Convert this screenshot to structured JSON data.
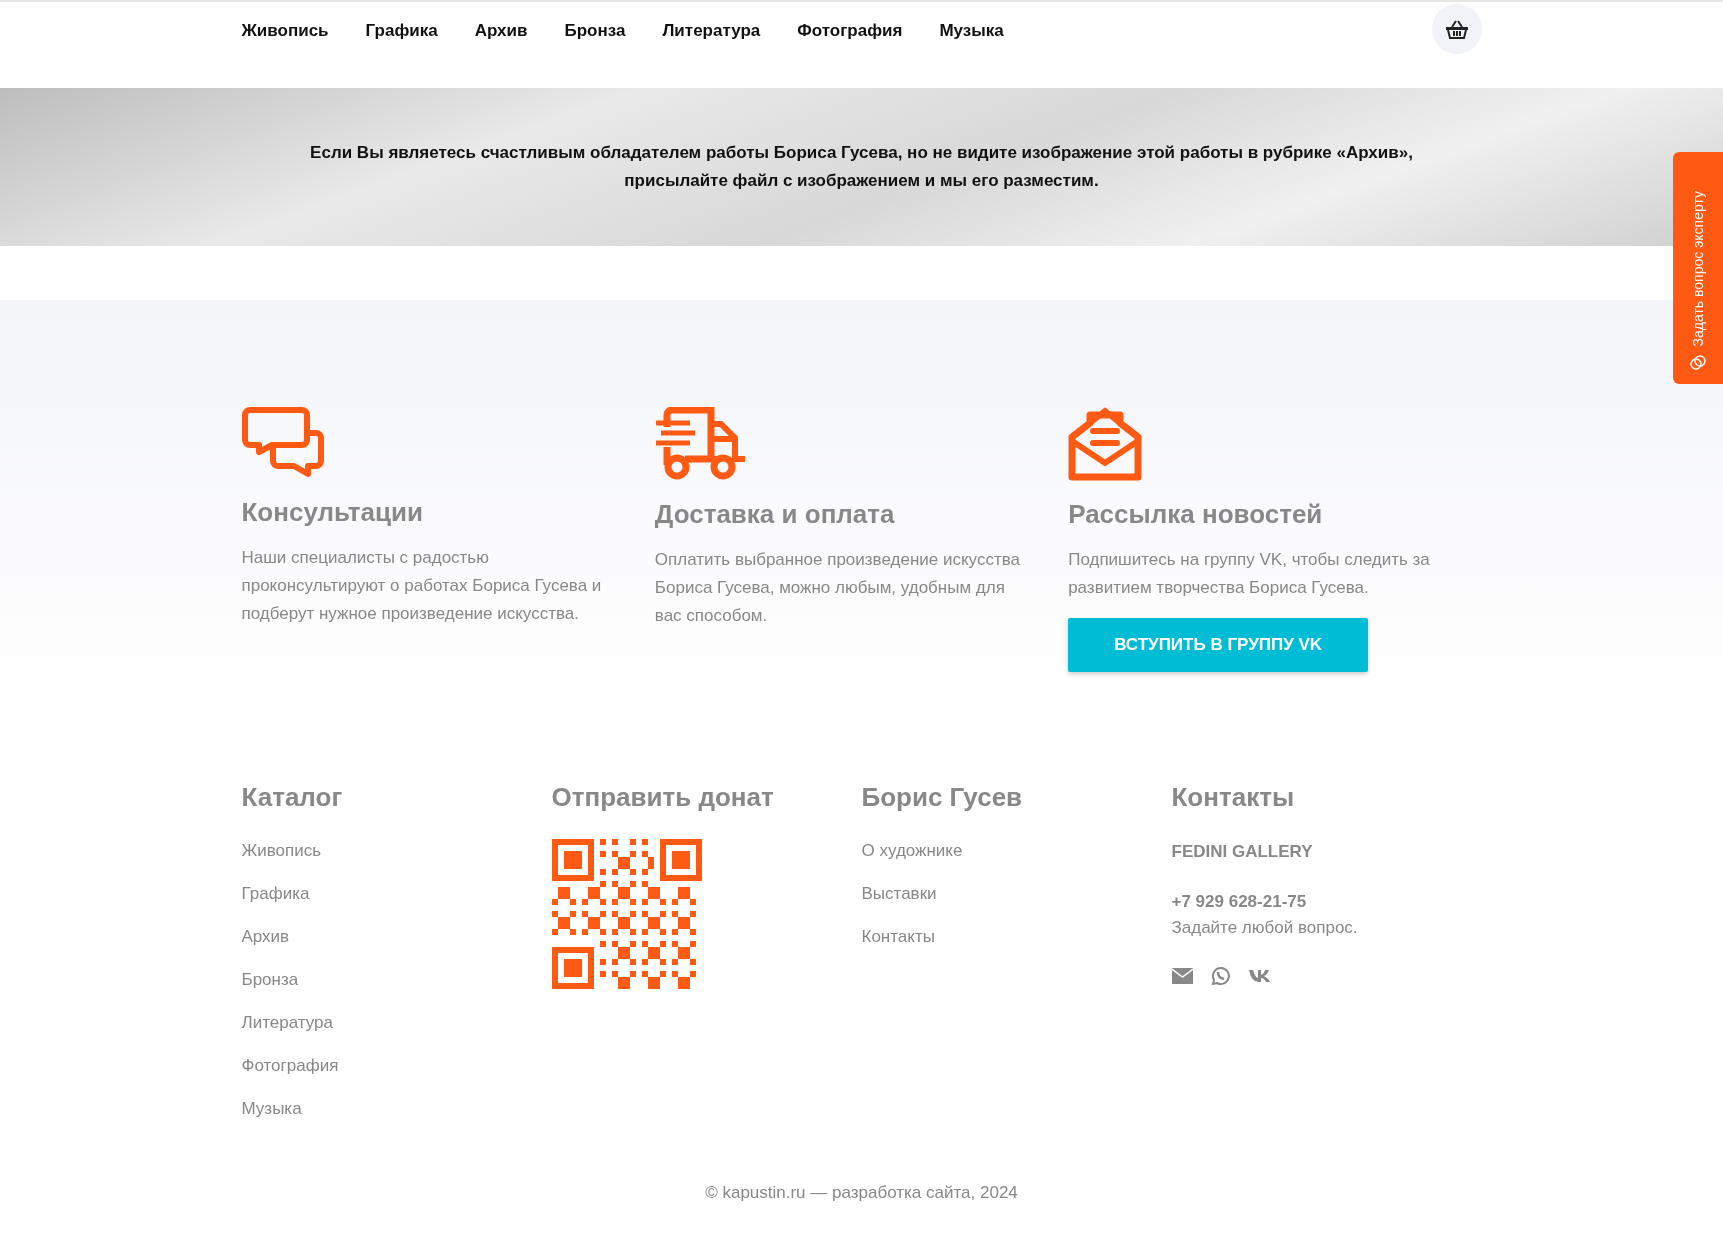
{
  "nav": {
    "items": [
      {
        "label": "Живопись"
      },
      {
        "label": "Графика"
      },
      {
        "label": "Архив"
      },
      {
        "label": "Бронза"
      },
      {
        "label": "Литература"
      },
      {
        "label": "Фотография"
      },
      {
        "label": "Музыка"
      }
    ]
  },
  "banner": {
    "text": "Если Вы являетесь счастливым обладателем работы Бориса Гусева, но не видите изображение этой работы в рубрике «Архив», присылайте файл с изображением и мы его разместим."
  },
  "side_tab": {
    "label": "Задать вопрос эксперту"
  },
  "features": [
    {
      "kind": "chat",
      "title": "Консультации",
      "text": "Наши специалисты с радостью проконсультируют о работах Бориса Гусева и подберут нужное произведение искусства."
    },
    {
      "kind": "truck",
      "title": "Доставка и оплата",
      "text": "Оплатить выбранное произведение искусства Бориса Гусева, можно любым, удобным для вас способом."
    },
    {
      "kind": "mail",
      "title": "Рассылка новостей",
      "text": "Подпишитесь на группу VK, чтобы следить за развитием творчества Бориса Гусева.",
      "button": "ВСТУПИТЬ В ГРУППУ VK"
    }
  ],
  "footer": {
    "catalog": {
      "title": "Каталог",
      "links": [
        "Живопись",
        "Графика",
        "Архив",
        "Бронза",
        "Литература",
        "Фотография",
        "Музыка"
      ]
    },
    "donate": {
      "title": "Отправить донат"
    },
    "artist": {
      "title": "Борис Гусев",
      "links": [
        "О художнике",
        "Выставки",
        "Контакты"
      ]
    },
    "contacts": {
      "title": "Контакты",
      "company": "FEDINI GALLERY",
      "phone": "+7 929 628-21-75",
      "note": "Задайте любой вопрос."
    },
    "copyright": "© kapustin.ru — разработка сайта, 2024"
  }
}
